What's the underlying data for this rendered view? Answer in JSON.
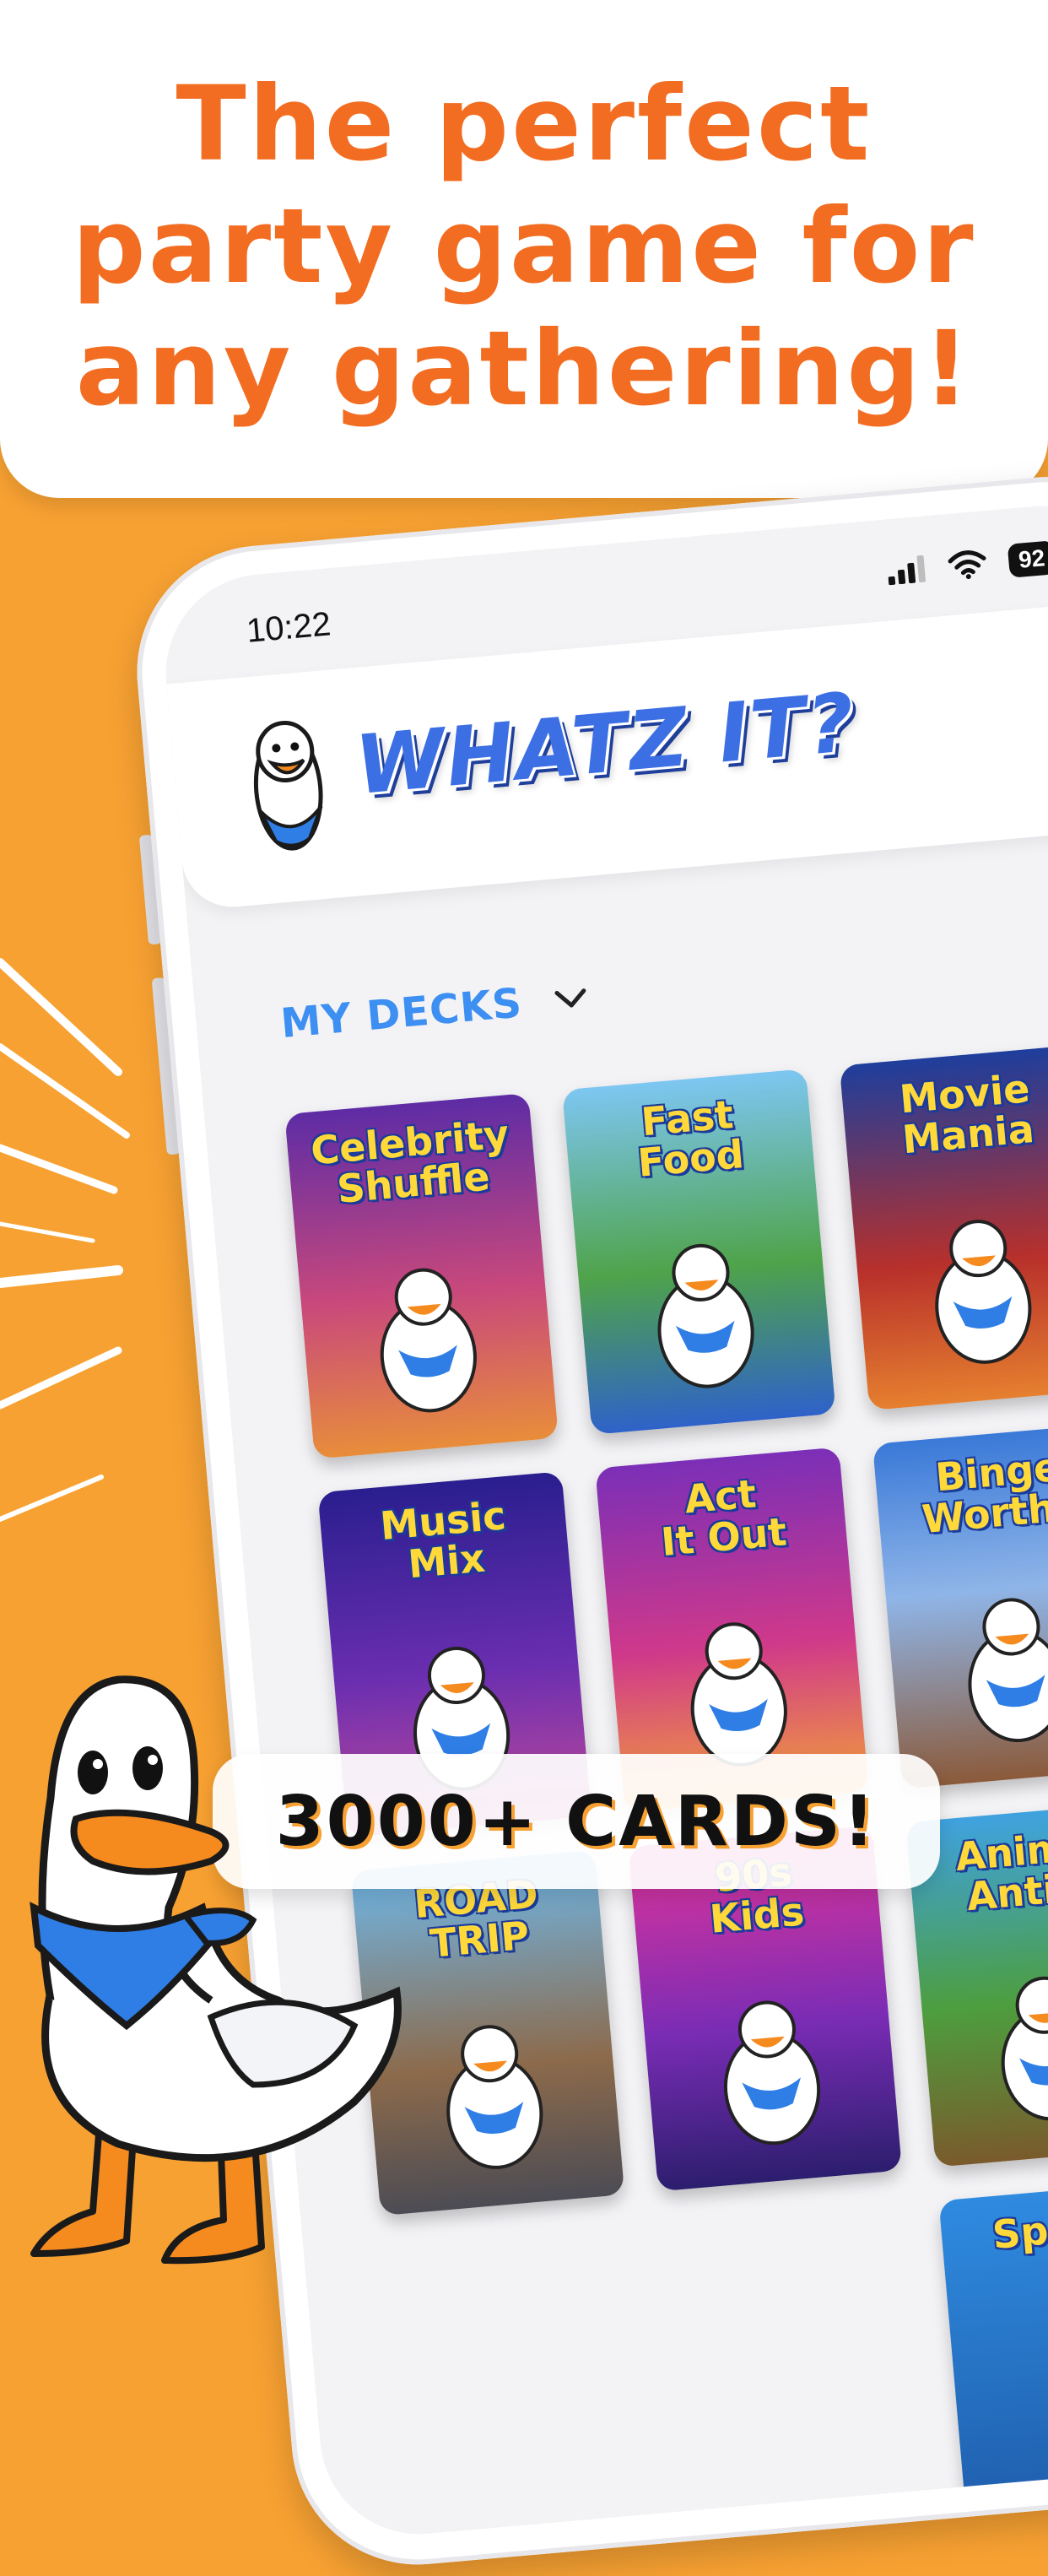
{
  "headline": "The perfect\nparty game for\nany gathering!",
  "status": {
    "time": "10:22",
    "battery": "92"
  },
  "app": {
    "logo_text": "WHATZ IT?"
  },
  "decks_section": {
    "label": "MY DECKS"
  },
  "decks": [
    {
      "title": "Celebrity\nShuffle"
    },
    {
      "title": "Fast\nFood"
    },
    {
      "title": "Movie\nMania"
    },
    {
      "title": "Music\nMix"
    },
    {
      "title": "Act\nIt Out"
    },
    {
      "title": "Binge\nWorthy"
    },
    {
      "title": "ROAD\nTRIP"
    },
    {
      "title": "90s\nKids"
    },
    {
      "title": "Animal\nAntics"
    },
    {
      "title": "Sports"
    }
  ],
  "badge": {
    "cards": "3000+ CARDS!"
  },
  "colors": {
    "background": "#F7A132",
    "headline": "#F26D21",
    "logo_blue": "#3C6FE4",
    "decks_blue": "#3D8FF1"
  },
  "icons": [
    "signal-icon",
    "wifi-icon",
    "battery-icon",
    "chevron-down-icon",
    "goose-mascot"
  ]
}
